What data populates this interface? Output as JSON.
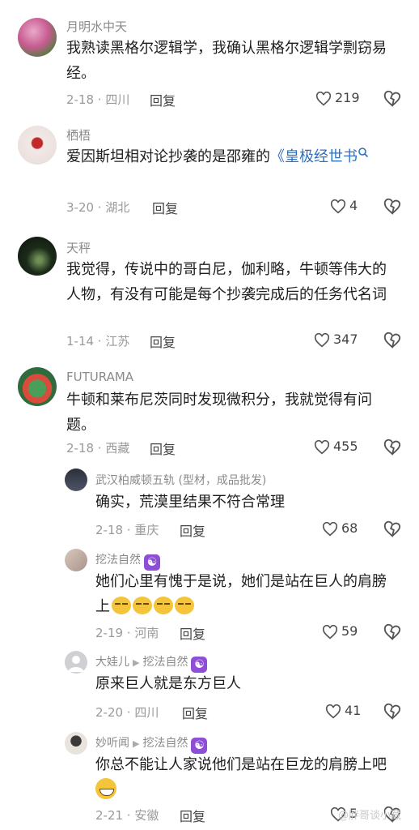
{
  "reply_label": "回复",
  "comments": [
    {
      "author": "月明水中天",
      "text": "我熟读黑格尔逻辑学，我确认黑格尔逻辑学剽窃易经。",
      "date_loc": "2-18 · 四川",
      "likes": "219"
    },
    {
      "author": "栖梧",
      "text": "爱因斯坦相对论抄袭的是邵雍的",
      "link": "《皇极经世书",
      "date_loc": "3-20 · 湖北",
      "likes": "4"
    },
    {
      "author": "天秤",
      "text": "我觉得，传说中的哥白尼，伽利略，牛顿等伟大的人物，有没有可能是每个抄袭完成后的任务代名词",
      "date_loc": "1-14 · 江苏",
      "likes": "347"
    },
    {
      "author": "FUTURAMA",
      "text": "牛顿和莱布尼茨同时发现微积分，我就觉得有问题。",
      "date_loc": "2-18 · 西藏",
      "likes": "455"
    }
  ],
  "replies": [
    {
      "author": "武汉柏威顿五轨 (型材，成品批发)",
      "text": "确实，荒漠里结果不符合常理",
      "date_loc": "2-18 · 重庆",
      "likes": "68"
    },
    {
      "author": "挖法自然",
      "text": "她们心里有愧于是说，她们是站在巨人的肩膀上",
      "date_loc": "2-19 · 河南",
      "likes": "59"
    },
    {
      "author": "大娃儿",
      "reply_to": "挖法自然",
      "text": "原来巨人就是东方巨人",
      "date_loc": "2-20 · 四川",
      "likes": "41"
    },
    {
      "author": "妙听闻",
      "reply_to": "挖法自然",
      "text": "你总不能让人家说他们是站在巨龙的肩膀上吧",
      "date_loc": "2-21 · 安徽",
      "likes": "5"
    }
  ],
  "watermark": "@胖哥谈小藏"
}
